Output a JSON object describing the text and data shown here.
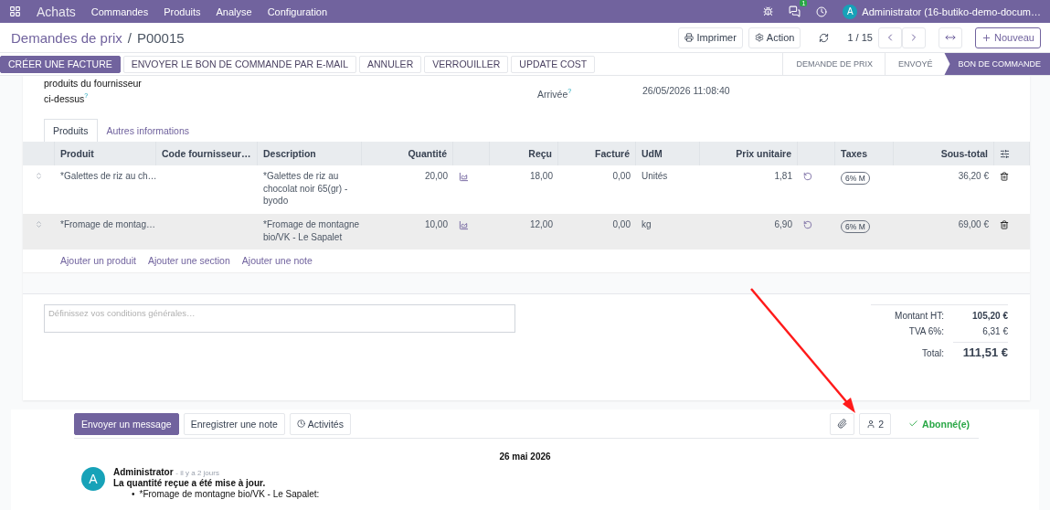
{
  "navbar": {
    "app": "Achats",
    "menus": [
      "Commandes",
      "Produits",
      "Analyse",
      "Configuration"
    ],
    "messages_count": "1",
    "user_initial": "A",
    "user_name": "Administrator (16-butiko-demo-docum…"
  },
  "breadcrumb": {
    "items": [
      "Demandes de prix",
      "P00015"
    ],
    "separator": "/"
  },
  "toolbar": {
    "print": "Imprimer",
    "action": "Action",
    "pager": "1 / 15",
    "new": "Nouveau"
  },
  "status_buttons": [
    {
      "label": "CRÉER UNE FACTURE",
      "highlighted": true
    },
    {
      "label": "ENVOYER LE BON DE COMMANDE PAR E-MAIL",
      "highlighted": false
    },
    {
      "label": "ANNULER",
      "highlighted": false
    },
    {
      "label": "VERROUILLER",
      "highlighted": false
    },
    {
      "label": "UPDATE COST",
      "highlighted": false
    }
  ],
  "stages": [
    {
      "label": "DEMANDE DE PRIX",
      "selected": false
    },
    {
      "label": "ENVOYÉ",
      "selected": false
    },
    {
      "label": "BON DE COMMANDE",
      "selected": true
    }
  ],
  "fields": {
    "left_label": [
      "produits du fournisseur",
      "ci-dessus"
    ],
    "left_help": "?",
    "right_label": "Arrivée",
    "right_help": "?",
    "right_value": "26/05/2026 11:08:40"
  },
  "tabs": [
    {
      "label": "Produits",
      "selected": true
    },
    {
      "label": "Autres informations",
      "selected": false
    }
  ],
  "table": {
    "columns": [
      "Produit",
      "Code fournisseur…",
      "Description",
      "Quantité",
      "Reçu",
      "Facturé",
      "UdM",
      "Prix unitaire",
      "Taxes",
      "Sous-total"
    ],
    "rows": [
      {
        "product": "*Galettes de riz au ch…",
        "description": "*Galettes de riz au chocolat noir 65(gr) - byodo",
        "quantity": "20,00",
        "received": "18,00",
        "invoiced": "0,00",
        "uom": "Unités",
        "unit_price": "1,81",
        "tax": "6% M",
        "subtotal": "36,20 €",
        "selected": false
      },
      {
        "product": "*Fromage de montag…",
        "description": "*Fromage de montagne bio/VK - Le Sapalet",
        "quantity": "10,00",
        "received": "12,00",
        "invoiced": "0,00",
        "uom": "kg",
        "unit_price": "6,90",
        "tax": "6% M",
        "subtotal": "69,00 €",
        "selected": true
      }
    ],
    "add_links": [
      "Ajouter un produit",
      "Ajouter une section",
      "Ajouter une note"
    ]
  },
  "notes": {
    "placeholder": "Définissez vos conditions générales…"
  },
  "totals": [
    {
      "label": "Montant HT:",
      "value": "105,20 €",
      "kind": "subtotal"
    },
    {
      "label": "TVA 6%:",
      "value": "6,31 €",
      "kind": "tax"
    },
    {
      "label": "Total:",
      "value": "111,51 €",
      "kind": "total"
    }
  ],
  "chatter": {
    "buttons": [
      {
        "label": "Envoyer un message",
        "selected": true
      },
      {
        "label": "Enregistrer une note",
        "selected": false
      },
      {
        "label": "Activités",
        "selected": false
      }
    ],
    "followers": "2",
    "follow": "Abonné(e)",
    "date": "26 mai 2026",
    "message": {
      "avatar": "A",
      "author": "Administrator",
      "time": "- il y a 2 jours",
      "title": "La quantité reçue a été mise à jour.",
      "items": [
        {
          "bullet": "•",
          "text": "*Fromage de montagne bio/VK - Le Sapalet:"
        }
      ]
    }
  }
}
